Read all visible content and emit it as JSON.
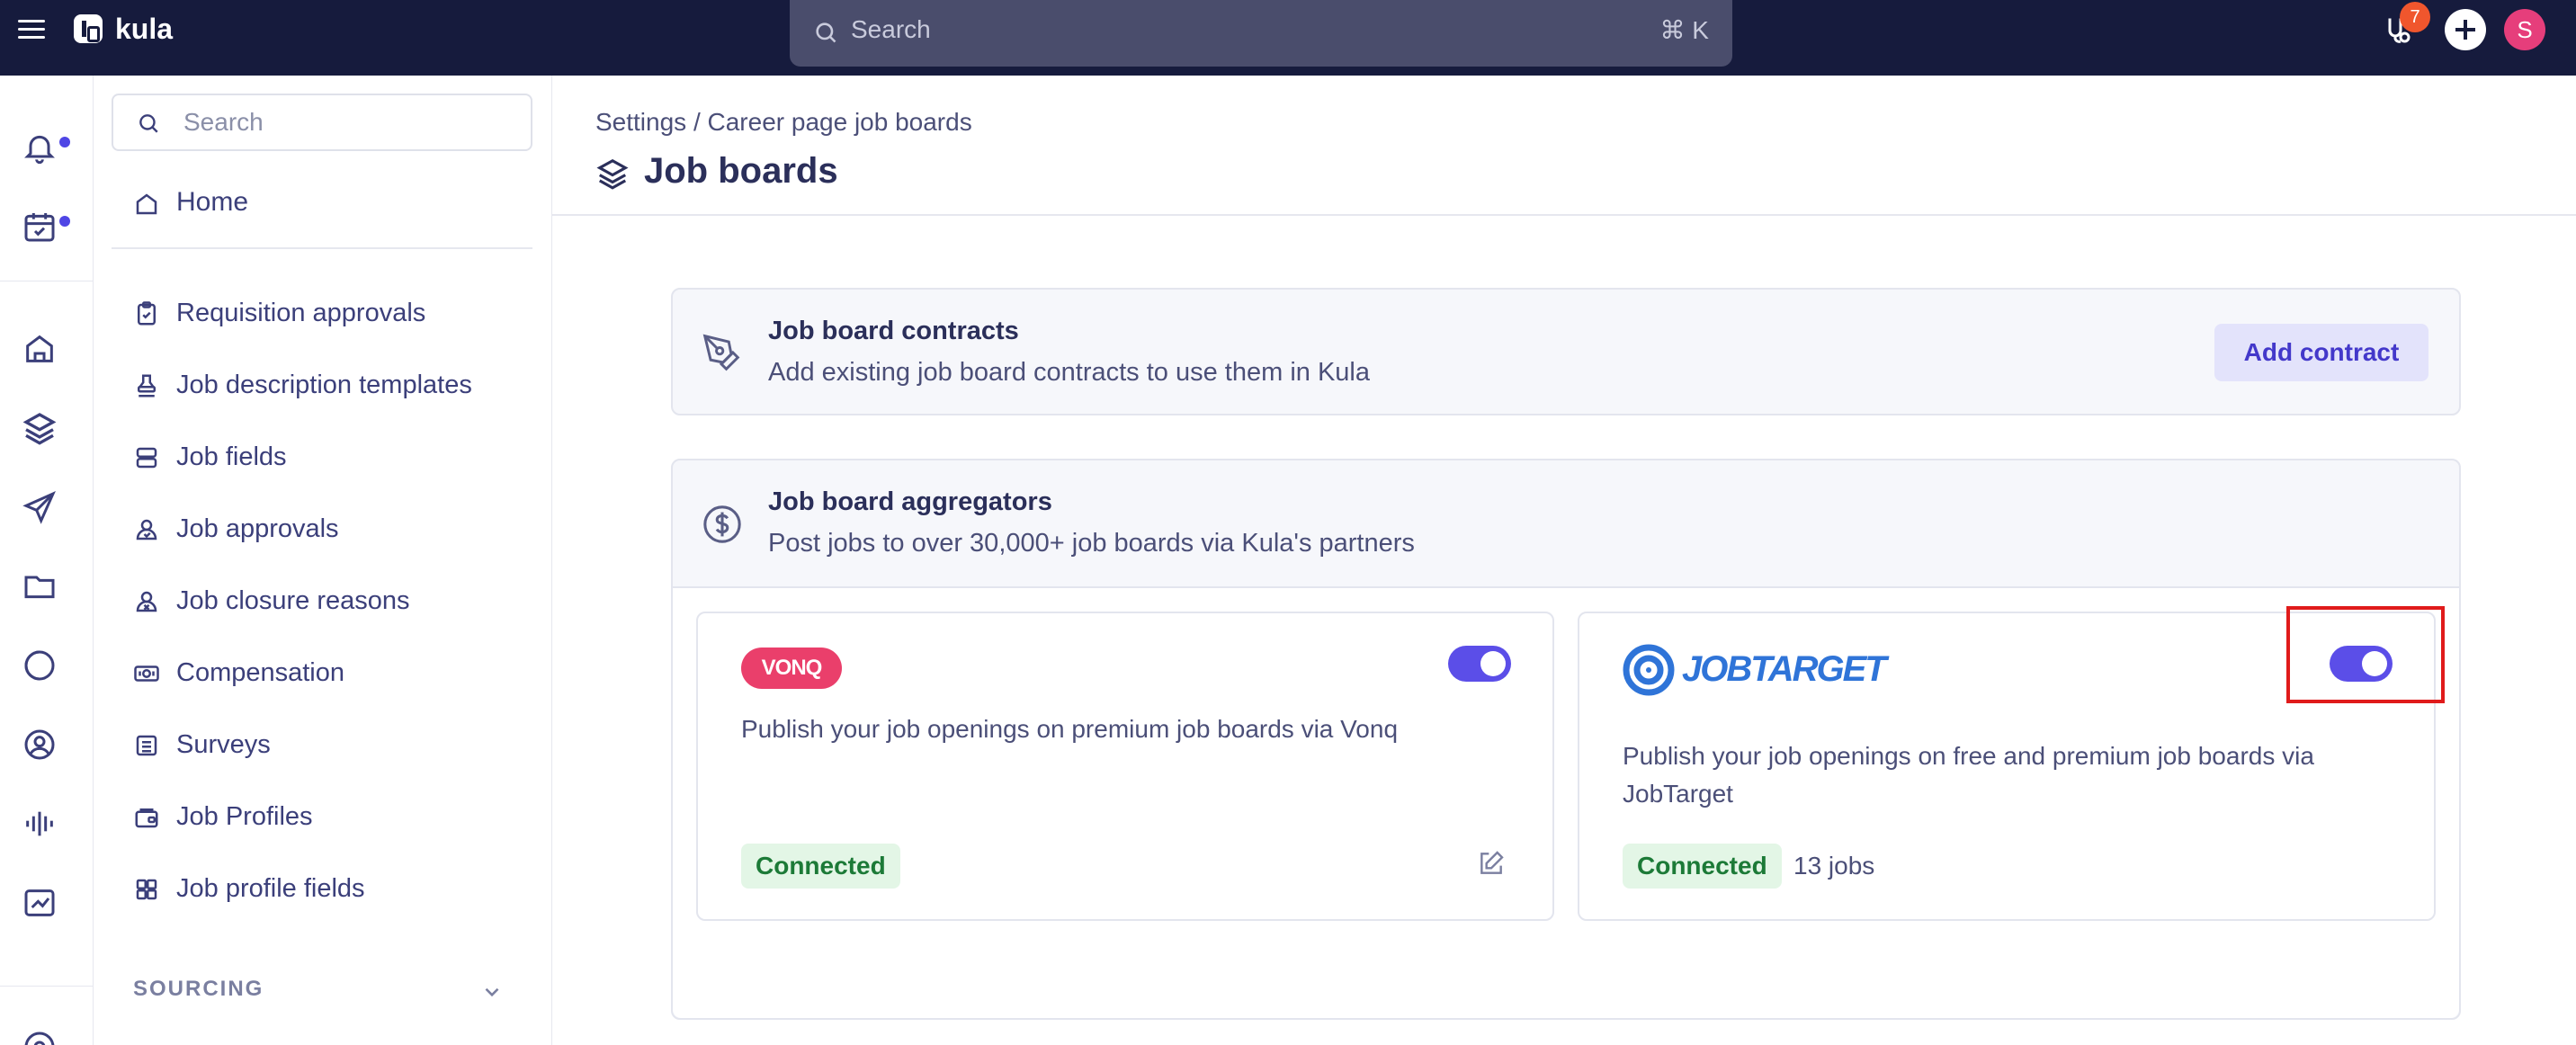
{
  "app": {
    "name": "kula"
  },
  "topbar": {
    "search_placeholder": "Search",
    "search_shortcut": "⌘ K",
    "notification_count": "7",
    "avatar_initial": "S"
  },
  "sidebar": {
    "search_placeholder": "Search",
    "home_label": "Home",
    "items": [
      {
        "label": "Requisition approvals",
        "icon": "clipboard-check-icon"
      },
      {
        "label": "Job description templates",
        "icon": "stamp-icon"
      },
      {
        "label": "Job fields",
        "icon": "fields-icon"
      },
      {
        "label": "Job approvals",
        "icon": "user-check-icon"
      },
      {
        "label": "Job closure reasons",
        "icon": "user-x-icon"
      },
      {
        "label": "Compensation",
        "icon": "banknote-icon"
      },
      {
        "label": "Surveys",
        "icon": "list-icon"
      },
      {
        "label": "Job Profiles",
        "icon": "wallet-icon"
      },
      {
        "label": "Job profile fields",
        "icon": "grid-icon"
      }
    ],
    "section_label": "SOURCING"
  },
  "main": {
    "breadcrumb": "Settings / Career page job boards",
    "title": "Job boards",
    "contracts": {
      "title": "Job board contracts",
      "description": "Add existing job board contracts to use them in Kula",
      "button_label": "Add contract"
    },
    "aggregators": {
      "title": "Job board aggregators",
      "description": "Post jobs to over 30,000+ job boards via Kula's partners",
      "partners": [
        {
          "logo_text": "VONQ",
          "description": "Publish your job openings on premium job boards via Vonq",
          "status": "Connected",
          "enabled": true
        },
        {
          "logo_text": "JOBTARGET",
          "description": "Publish your job openings on free and premium job boards via JobTarget",
          "status": "Connected",
          "jobs": "13 jobs",
          "enabled": true
        }
      ]
    }
  },
  "colors": {
    "topbar": "#161b3d",
    "accent": "#5b4ee8",
    "connected_bg": "#e3f6e6",
    "connected_text": "#1c7a37",
    "vonq": "#ea3f6b",
    "jobtarget": "#2f74d8",
    "highlight": "#e01b1b"
  }
}
